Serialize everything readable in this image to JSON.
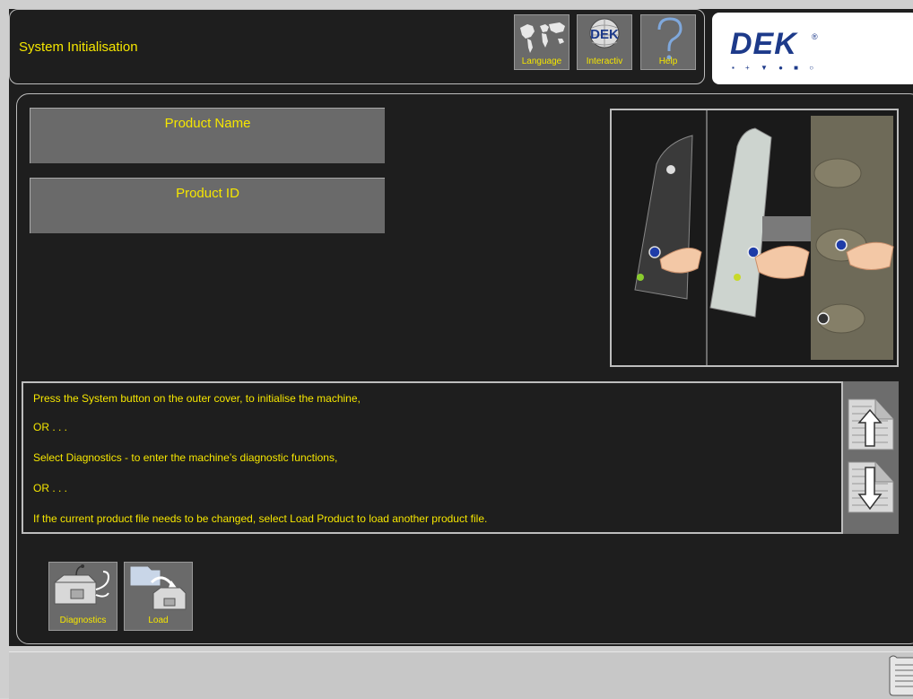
{
  "header": {
    "title": "System Initialisation",
    "buttons": [
      {
        "label": "Language",
        "icon": "world-map-icon"
      },
      {
        "label": "Interactiv",
        "icon": "dek-interactive-icon",
        "icon_text": "DEK"
      },
      {
        "label": "Help",
        "icon": "question-mark-icon"
      }
    ]
  },
  "logo": {
    "brand": "DEK",
    "reg": "®",
    "dots": "▪ + ▼ ● ■ ○"
  },
  "fields": {
    "product_name": {
      "label": "Product Name",
      "value": ""
    },
    "product_id": {
      "label": "Product ID",
      "value": ""
    }
  },
  "instructions": [
    "Press the System button on the outer cover, to initialise the machine,",
    "OR . . .",
    "Select Diagnostics - to enter the machine’s diagnostic functions,",
    "OR . . .",
    "If the current product file needs to be changed, select Load Product to load another product file."
  ],
  "scroll": {
    "up_icon": "scroll-up-arrow-icon",
    "down_icon": "scroll-down-arrow-icon"
  },
  "actions": [
    {
      "label": "Diagnostics",
      "icon": "stethoscope-machine-icon"
    },
    {
      "label": "Load",
      "icon": "load-product-icon"
    }
  ],
  "colors": {
    "accent_text": "#f5e600",
    "button_bg": "#6a6a6a",
    "background": "#1e1e1e",
    "logo_blue": "#1d3a8a"
  }
}
